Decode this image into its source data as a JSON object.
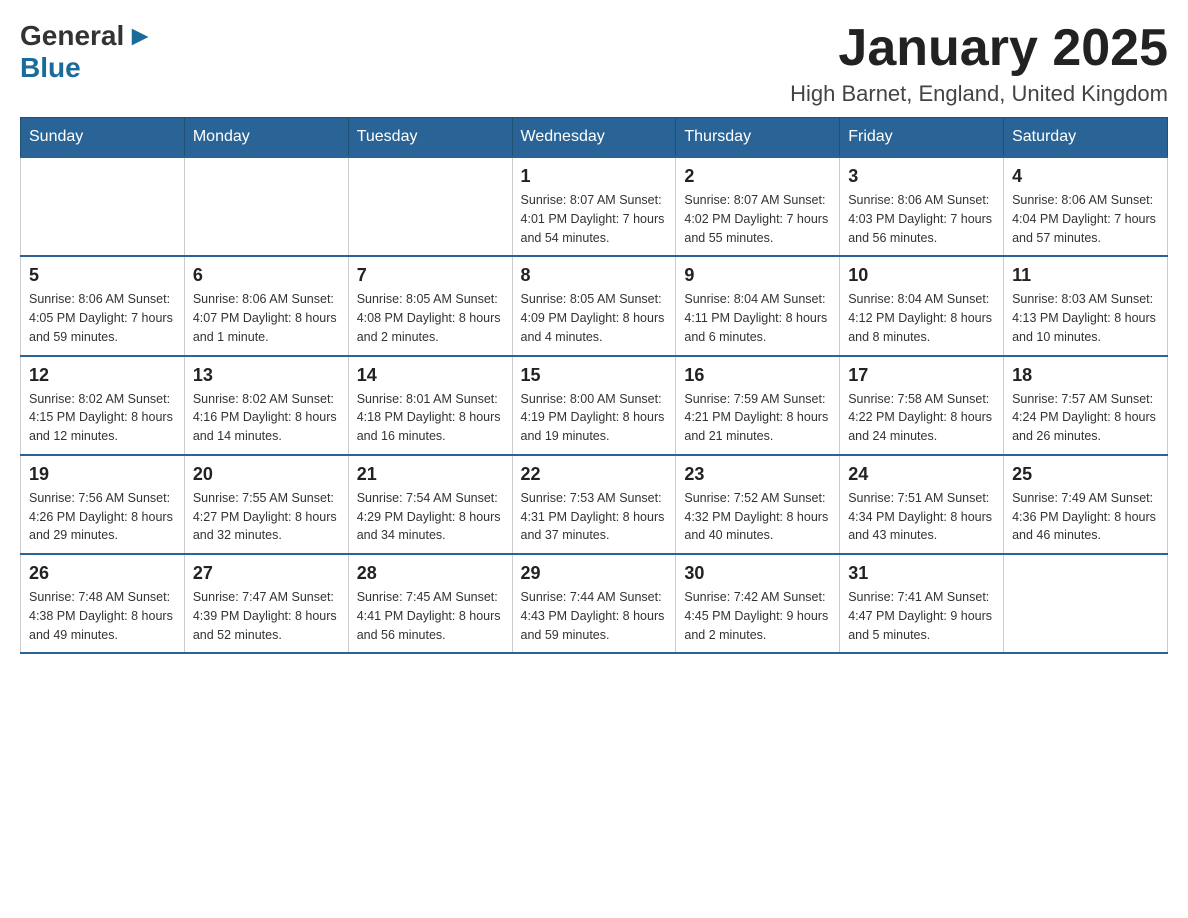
{
  "logo": {
    "general": "General",
    "blue": "Blue"
  },
  "header": {
    "title": "January 2025",
    "location": "High Barnet, England, United Kingdom"
  },
  "days_of_week": [
    "Sunday",
    "Monday",
    "Tuesday",
    "Wednesday",
    "Thursday",
    "Friday",
    "Saturday"
  ],
  "weeks": [
    [
      {
        "day": "",
        "info": ""
      },
      {
        "day": "",
        "info": ""
      },
      {
        "day": "",
        "info": ""
      },
      {
        "day": "1",
        "info": "Sunrise: 8:07 AM\nSunset: 4:01 PM\nDaylight: 7 hours\nand 54 minutes."
      },
      {
        "day": "2",
        "info": "Sunrise: 8:07 AM\nSunset: 4:02 PM\nDaylight: 7 hours\nand 55 minutes."
      },
      {
        "day": "3",
        "info": "Sunrise: 8:06 AM\nSunset: 4:03 PM\nDaylight: 7 hours\nand 56 minutes."
      },
      {
        "day": "4",
        "info": "Sunrise: 8:06 AM\nSunset: 4:04 PM\nDaylight: 7 hours\nand 57 minutes."
      }
    ],
    [
      {
        "day": "5",
        "info": "Sunrise: 8:06 AM\nSunset: 4:05 PM\nDaylight: 7 hours\nand 59 minutes."
      },
      {
        "day": "6",
        "info": "Sunrise: 8:06 AM\nSunset: 4:07 PM\nDaylight: 8 hours\nand 1 minute."
      },
      {
        "day": "7",
        "info": "Sunrise: 8:05 AM\nSunset: 4:08 PM\nDaylight: 8 hours\nand 2 minutes."
      },
      {
        "day": "8",
        "info": "Sunrise: 8:05 AM\nSunset: 4:09 PM\nDaylight: 8 hours\nand 4 minutes."
      },
      {
        "day": "9",
        "info": "Sunrise: 8:04 AM\nSunset: 4:11 PM\nDaylight: 8 hours\nand 6 minutes."
      },
      {
        "day": "10",
        "info": "Sunrise: 8:04 AM\nSunset: 4:12 PM\nDaylight: 8 hours\nand 8 minutes."
      },
      {
        "day": "11",
        "info": "Sunrise: 8:03 AM\nSunset: 4:13 PM\nDaylight: 8 hours\nand 10 minutes."
      }
    ],
    [
      {
        "day": "12",
        "info": "Sunrise: 8:02 AM\nSunset: 4:15 PM\nDaylight: 8 hours\nand 12 minutes."
      },
      {
        "day": "13",
        "info": "Sunrise: 8:02 AM\nSunset: 4:16 PM\nDaylight: 8 hours\nand 14 minutes."
      },
      {
        "day": "14",
        "info": "Sunrise: 8:01 AM\nSunset: 4:18 PM\nDaylight: 8 hours\nand 16 minutes."
      },
      {
        "day": "15",
        "info": "Sunrise: 8:00 AM\nSunset: 4:19 PM\nDaylight: 8 hours\nand 19 minutes."
      },
      {
        "day": "16",
        "info": "Sunrise: 7:59 AM\nSunset: 4:21 PM\nDaylight: 8 hours\nand 21 minutes."
      },
      {
        "day": "17",
        "info": "Sunrise: 7:58 AM\nSunset: 4:22 PM\nDaylight: 8 hours\nand 24 minutes."
      },
      {
        "day": "18",
        "info": "Sunrise: 7:57 AM\nSunset: 4:24 PM\nDaylight: 8 hours\nand 26 minutes."
      }
    ],
    [
      {
        "day": "19",
        "info": "Sunrise: 7:56 AM\nSunset: 4:26 PM\nDaylight: 8 hours\nand 29 minutes."
      },
      {
        "day": "20",
        "info": "Sunrise: 7:55 AM\nSunset: 4:27 PM\nDaylight: 8 hours\nand 32 minutes."
      },
      {
        "day": "21",
        "info": "Sunrise: 7:54 AM\nSunset: 4:29 PM\nDaylight: 8 hours\nand 34 minutes."
      },
      {
        "day": "22",
        "info": "Sunrise: 7:53 AM\nSunset: 4:31 PM\nDaylight: 8 hours\nand 37 minutes."
      },
      {
        "day": "23",
        "info": "Sunrise: 7:52 AM\nSunset: 4:32 PM\nDaylight: 8 hours\nand 40 minutes."
      },
      {
        "day": "24",
        "info": "Sunrise: 7:51 AM\nSunset: 4:34 PM\nDaylight: 8 hours\nand 43 minutes."
      },
      {
        "day": "25",
        "info": "Sunrise: 7:49 AM\nSunset: 4:36 PM\nDaylight: 8 hours\nand 46 minutes."
      }
    ],
    [
      {
        "day": "26",
        "info": "Sunrise: 7:48 AM\nSunset: 4:38 PM\nDaylight: 8 hours\nand 49 minutes."
      },
      {
        "day": "27",
        "info": "Sunrise: 7:47 AM\nSunset: 4:39 PM\nDaylight: 8 hours\nand 52 minutes."
      },
      {
        "day": "28",
        "info": "Sunrise: 7:45 AM\nSunset: 4:41 PM\nDaylight: 8 hours\nand 56 minutes."
      },
      {
        "day": "29",
        "info": "Sunrise: 7:44 AM\nSunset: 4:43 PM\nDaylight: 8 hours\nand 59 minutes."
      },
      {
        "day": "30",
        "info": "Sunrise: 7:42 AM\nSunset: 4:45 PM\nDaylight: 9 hours\nand 2 minutes."
      },
      {
        "day": "31",
        "info": "Sunrise: 7:41 AM\nSunset: 4:47 PM\nDaylight: 9 hours\nand 5 minutes."
      },
      {
        "day": "",
        "info": ""
      }
    ]
  ]
}
